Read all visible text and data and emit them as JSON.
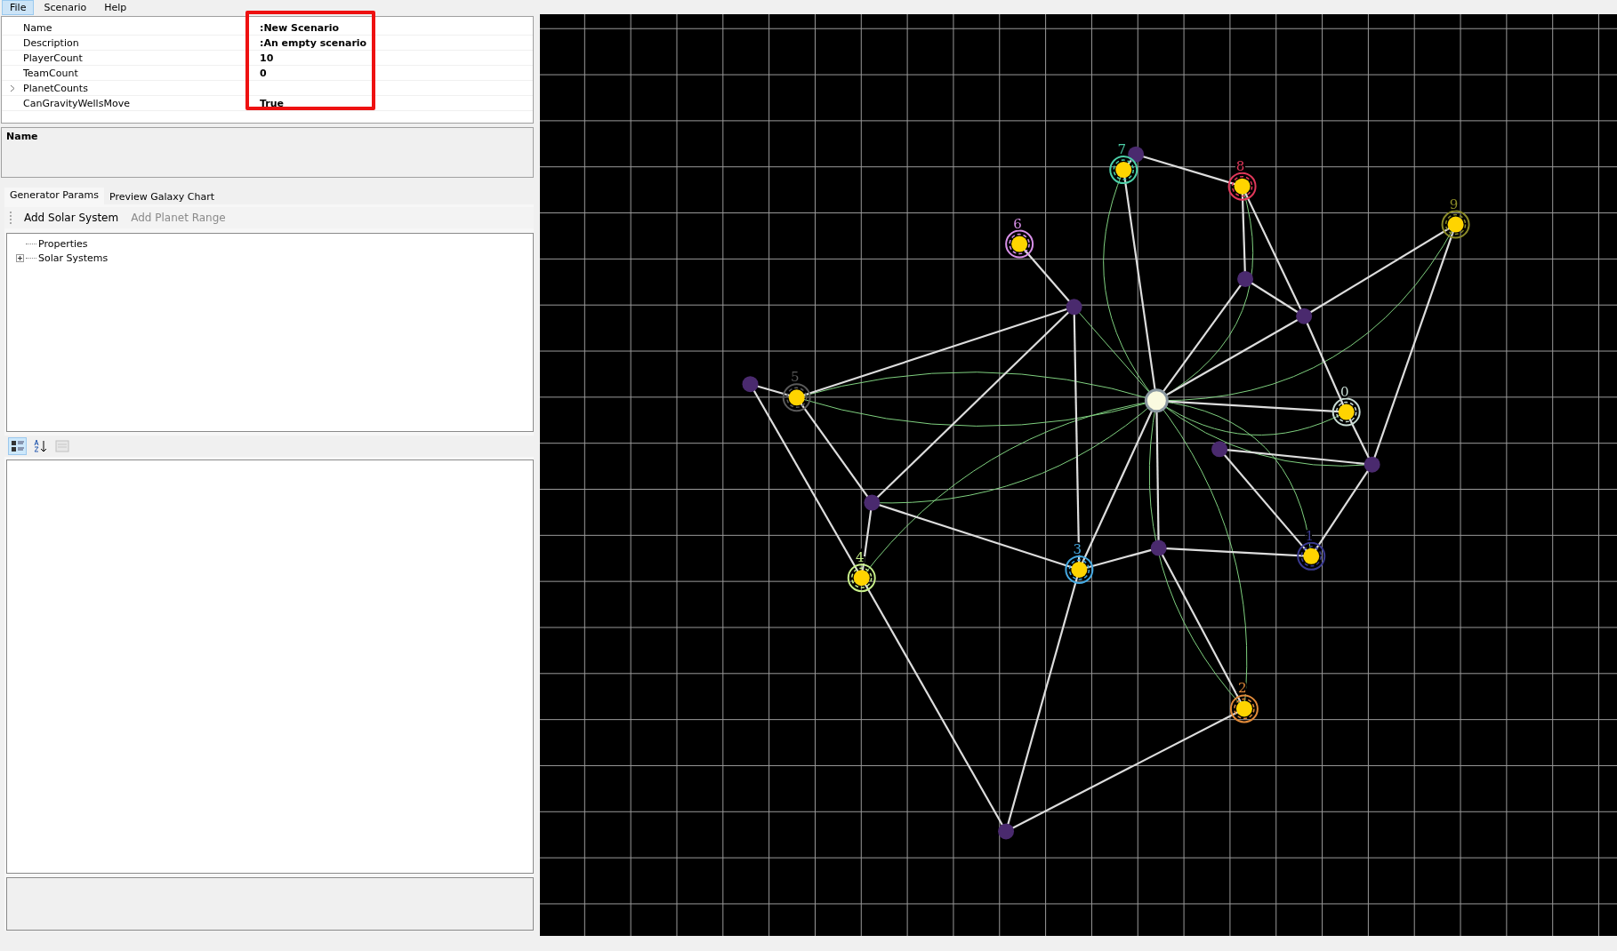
{
  "menu": [
    {
      "label": "File",
      "selected": true
    },
    {
      "label": "Scenario",
      "selected": false
    },
    {
      "label": "Help",
      "selected": false
    }
  ],
  "properties": {
    "highlight_values": true,
    "rows": [
      {
        "name": "Name",
        "value": ":New Scenario",
        "expandable": false
      },
      {
        "name": "Description",
        "value": ":An empty scenario",
        "expandable": false
      },
      {
        "name": "PlayerCount",
        "value": "10",
        "expandable": false
      },
      {
        "name": "TeamCount",
        "value": "0",
        "expandable": false
      },
      {
        "name": "PlanetCounts",
        "expandable": true
      },
      {
        "name": "CanGravityWellsMove",
        "value": "True",
        "expandable": false
      }
    ]
  },
  "description": {
    "title": "Name"
  },
  "tabs": [
    {
      "label": "Generator Params",
      "selected": true
    },
    {
      "label": "Preview Galaxy Chart",
      "selected": false
    }
  ],
  "toolbar": [
    {
      "label": "Add Solar System",
      "disabled": false
    },
    {
      "label": "Add Planet Range",
      "disabled": true
    }
  ],
  "tree": [
    {
      "label": "Properties",
      "expandable": false
    },
    {
      "label": "Solar Systems",
      "expandable": true,
      "expanded": false
    }
  ],
  "grid_toolbar": [
    {
      "kind": "categorized",
      "selected": true,
      "disabled": false
    },
    {
      "kind": "alphabetical",
      "selected": false,
      "disabled": false
    },
    {
      "kind": "property-pages",
      "selected": false,
      "disabled": true
    }
  ],
  "galaxy": {
    "players": [
      {
        "label": "0",
        "color": "#c8dcd4"
      },
      {
        "label": "1",
        "color": "#3a3a90"
      },
      {
        "label": "2",
        "color": "#e08a3a"
      },
      {
        "label": "3",
        "color": "#44a8e0"
      },
      {
        "label": "4",
        "color": "#c8f08a"
      },
      {
        "label": "5",
        "color": "#5a5a5a"
      },
      {
        "label": "6",
        "color": "#d890e8"
      },
      {
        "label": "7",
        "color": "#4cd0a8"
      },
      {
        "label": "8",
        "color": "#e0385a"
      },
      {
        "label": "9",
        "color": "#8a8a28"
      }
    ]
  }
}
